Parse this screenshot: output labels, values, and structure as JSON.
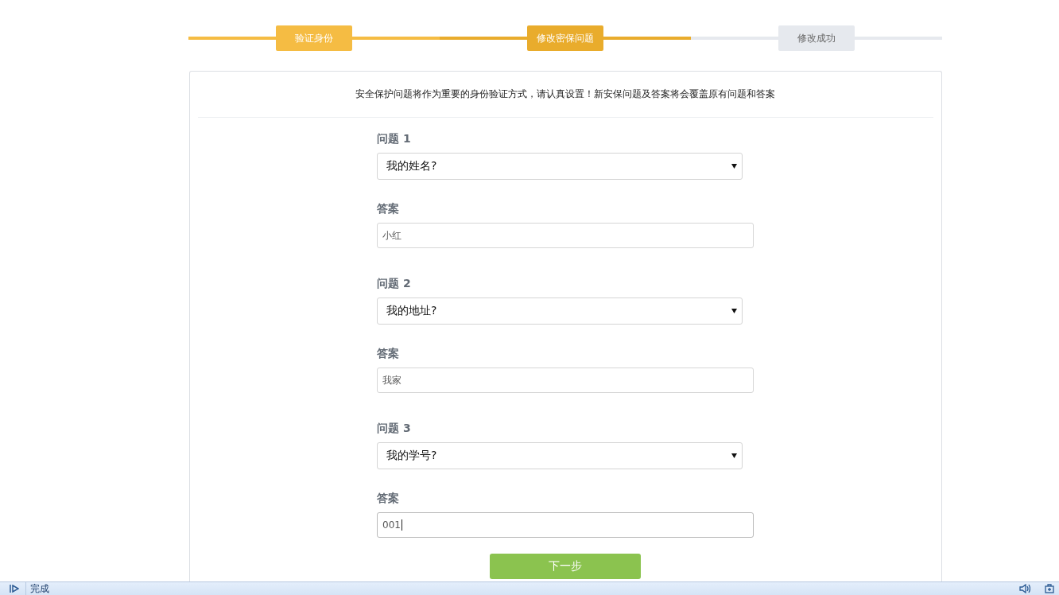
{
  "steps": [
    {
      "label": "验证身份",
      "kind": "done"
    },
    {
      "label": "修改密保问题",
      "kind": "current"
    },
    {
      "label": "修改成功",
      "kind": "pending"
    }
  ],
  "notice": "安全保护问题将作为重要的身份验证方式，请认真设置！新安保问题及答案将会覆盖原有问题和答案",
  "questions": [
    {
      "label": "问题",
      "number": "1",
      "question": "我的姓名?",
      "answer_label": "答案",
      "answer": "小红",
      "focused": false
    },
    {
      "label": "问题",
      "number": "2",
      "question": "我的地址?",
      "answer_label": "答案",
      "answer": "我家",
      "focused": false
    },
    {
      "label": "问题",
      "number": "3",
      "question": "我的学号?",
      "answer_label": "答案",
      "answer": "001",
      "focused": true
    }
  ],
  "next_button": "下一步",
  "status_bar": {
    "text": "完成"
  }
}
